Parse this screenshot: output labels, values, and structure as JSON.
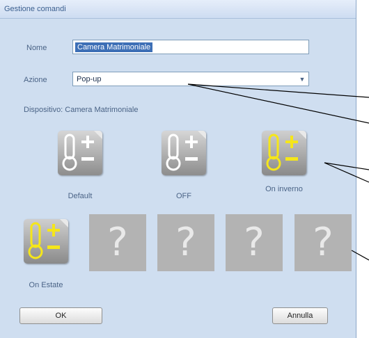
{
  "window": {
    "title": "Gestione comandi"
  },
  "form": {
    "name_label": "Nome",
    "name_value": "Camera Matrimoniale",
    "action_label": "Azione",
    "action_value": "Pop-up",
    "device_text": "Dispositivo: Camera Matrimoniale"
  },
  "commands": [
    {
      "label": "Default",
      "icon": "thermometer-plus-minus-icon",
      "color": "#ffffff"
    },
    {
      "label": "OFF",
      "icon": "thermometer-plus-minus-icon",
      "color": "#ffffff"
    },
    {
      "label": "On inverno",
      "icon": "thermometer-plus-minus-icon",
      "color": "#f5e61a"
    },
    {
      "label": "On Estate",
      "icon": "thermometer-plus-minus-icon",
      "color": "#f5e61a"
    }
  ],
  "empty_slots": [
    "?",
    "?",
    "?",
    "?"
  ],
  "buttons": {
    "ok": "OK",
    "cancel": "Annulla"
  },
  "colors": {
    "dialog_bg": "#cfdef0",
    "active_icon": "#f5e61a",
    "empty_slot": "#b3b3b3"
  }
}
